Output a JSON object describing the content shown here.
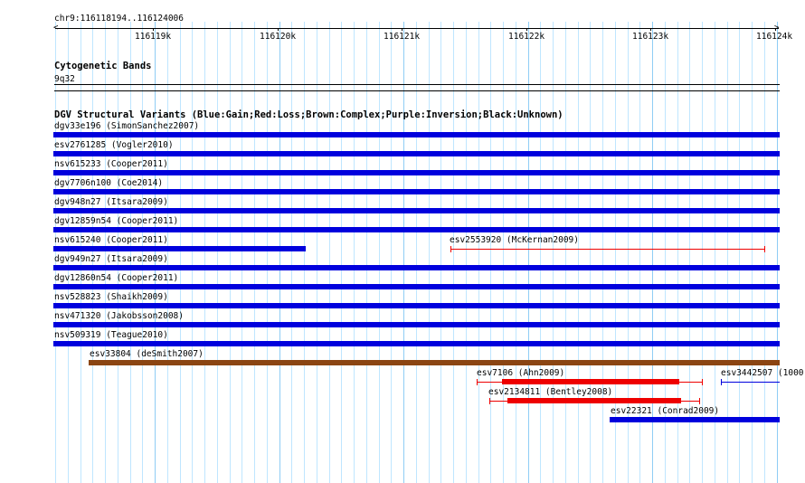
{
  "header": {
    "location": "chr9:116118194..116124006"
  },
  "ruler": {
    "ticks": [
      "116119k",
      "116120k",
      "116121k",
      "116122k",
      "116123k",
      "116124k"
    ]
  },
  "cytoband": {
    "title": "Cytogenetic Bands",
    "band": "9q32"
  },
  "dgv": {
    "title": "DGV Structural Variants (Blue:Gain;Red:Loss;Brown:Complex;Purple:Inversion;Black:Unknown)",
    "colors": {
      "gain": "#0000dd",
      "loss": "#ee0000",
      "complex": "#8b4513",
      "grid": "#bfe6ff"
    },
    "features": [
      {
        "label": "dgv33e196 (SimonSanchez2007)",
        "type": "gain"
      },
      {
        "label": "esv2761285 (Vogler2010)",
        "type": "gain"
      },
      {
        "label": "nsv615233 (Cooper2011)",
        "type": "gain"
      },
      {
        "label": "dgv7706n100 (Coe2014)",
        "type": "gain"
      },
      {
        "label": "dgv948n27 (Itsara2009)",
        "type": "gain"
      },
      {
        "label": "dgv12859n54 (Cooper2011)",
        "type": "gain"
      },
      {
        "label": "nsv615240 (Cooper2011)",
        "type": "gain"
      },
      {
        "label": "esv2553920 (McKernan2009)",
        "type": "loss"
      },
      {
        "label": "dgv949n27 (Itsara2009)",
        "type": "gain"
      },
      {
        "label": "dgv12860n54 (Cooper2011)",
        "type": "gain"
      },
      {
        "label": "nsv528823 (Shaikh2009)",
        "type": "gain"
      },
      {
        "label": "nsv471320 (Jakobsson2008)",
        "type": "gain"
      },
      {
        "label": "nsv509319 (Teague2010)",
        "type": "gain"
      },
      {
        "label": "esv33804 (deSmith2007)",
        "type": "complex"
      },
      {
        "label": "esv7106 (Ahn2009)",
        "type": "loss"
      },
      {
        "label": "esv3442507 (1000",
        "type": "gain"
      },
      {
        "label": "esv2134811 (Bentley2008)",
        "type": "loss"
      },
      {
        "label": "esv22321 (Conrad2009)",
        "type": "gain"
      }
    ]
  }
}
